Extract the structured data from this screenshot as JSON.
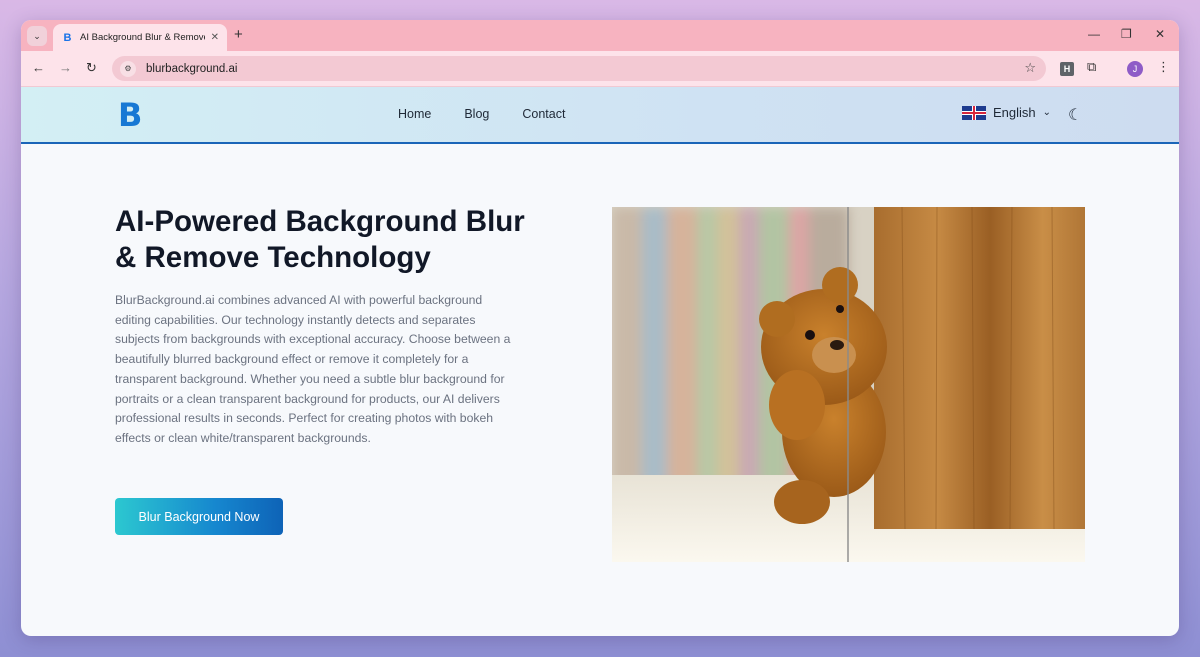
{
  "browser": {
    "tab_title": "AI Background Blur & Remove",
    "url": "blurbackground.ai",
    "profile_initial": "J",
    "extension_letter": "H"
  },
  "site": {
    "logo_text": "B",
    "nav": [
      "Home",
      "Blog",
      "Contact"
    ],
    "language": "English"
  },
  "hero": {
    "title": "AI-Powered Background Blur & Remove Technology",
    "description": "BlurBackground.ai combines advanced AI with powerful background editing capabilities. Our technology instantly detects and separates subjects from backgrounds with exceptional accuracy. Choose between a beautifully blurred background effect or remove it completely for a transparent background. Whether you need a subtle blur background for portraits or a clean transparent background for products, our AI delivers professional results in seconds. Perfect for creating photos with bokeh effects or clean white/transparent backgrounds.",
    "cta_label": "Blur Background Now"
  },
  "colors": {
    "accent": "#1687cf",
    "header_border": "#1a65b8"
  }
}
